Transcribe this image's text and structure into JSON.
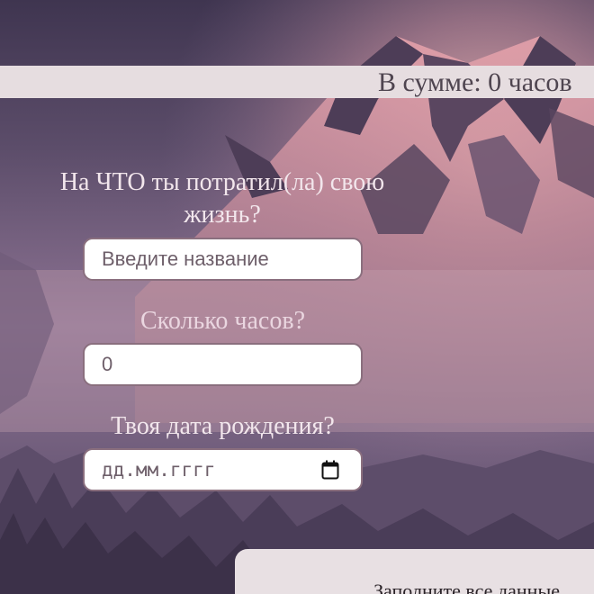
{
  "summary": {
    "total_text": "В сумме: 0 часов"
  },
  "form": {
    "question_what": "На ЧТО ты потратил(ла) свою жизнь?",
    "name_placeholder": "Введите название",
    "question_hours": "Сколько часов?",
    "hours_value": "0",
    "question_birth": "Твоя дата рождения?",
    "date_placeholder": "дд.мм.гггг",
    "date_icon": "calendar-icon"
  },
  "info": {
    "message": "Заполните все данные"
  },
  "colors": {
    "sky_top": "#3f3550",
    "sky_mid": "#8d7393",
    "sunset_pink": "#f2b8b4",
    "bar_bg": "#e6dde0",
    "field_border": "#8a6f7e"
  }
}
